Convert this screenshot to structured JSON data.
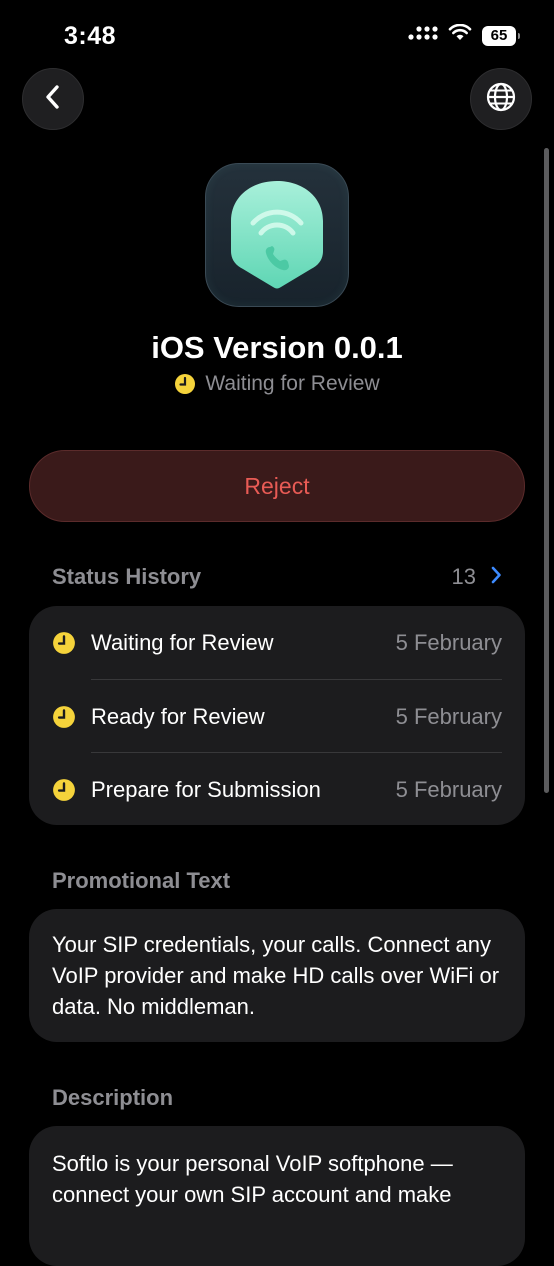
{
  "status_bar": {
    "time": "3:48",
    "battery": "65"
  },
  "nav": {
    "back_icon": "chevron-left-icon",
    "globe_icon": "globe-icon"
  },
  "app": {
    "icon": "phone-shield-app-icon",
    "title": "iOS Version 0.0.1",
    "status": "Waiting for Review",
    "status_color": "#f5d33b"
  },
  "actions": {
    "reject_label": "Reject",
    "reject_color": "#e85b55"
  },
  "status_history": {
    "header": "Status History",
    "count": "13",
    "items": [
      {
        "label": "Waiting for Review",
        "date": "5 February"
      },
      {
        "label": "Ready for Review",
        "date": "5 February"
      },
      {
        "label": "Prepare for Submission",
        "date": "5 February"
      }
    ]
  },
  "promotional": {
    "header": "Promotional Text",
    "text": "Your SIP credentials, your calls. Connect any VoIP provider and make HD calls over WiFi or data. No middleman."
  },
  "description": {
    "header": "Description",
    "text": "Softlo is your personal VoIP softphone — connect your own SIP account and make"
  }
}
